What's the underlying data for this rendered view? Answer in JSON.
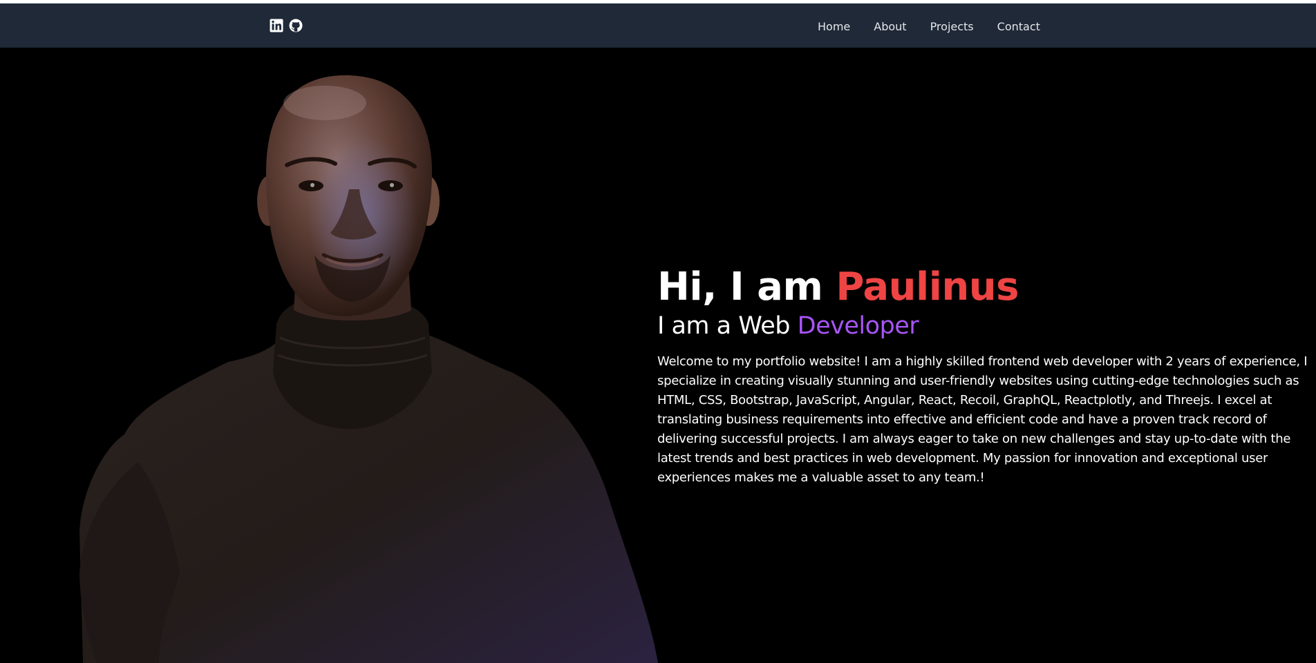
{
  "navbar": {
    "social": [
      {
        "icon": "linkedin-icon"
      },
      {
        "icon": "github-icon"
      }
    ],
    "links": [
      {
        "label": "Home"
      },
      {
        "label": "About"
      },
      {
        "label": "Projects"
      },
      {
        "label": "Contact"
      }
    ]
  },
  "hero": {
    "greeting_prefix": "Hi, I am ",
    "name": "Paulinus",
    "role_prefix": "I am a Web ",
    "role_highlight": "Developer",
    "bio": "Welcome to my portfolio website! I am a highly skilled frontend web developer with 2 years of experience, I specialize in creating visually stunning and user-friendly websites using cutting-edge technologies such as HTML, CSS, Bootstrap, JavaScript, Angular, React, Recoil, GraphQL, Reactplotly, and Threejs. I excel at translating business requirements into effective and efficient code and have a proven track record of delivering successful projects. I am always eager to take on new challenges and stay up-to-date with the latest trends and best practices in web development. My passion for innovation and exceptional user experiences makes me a valuable asset to any team.!"
  },
  "colors": {
    "navbar_bg": "#1f2937",
    "page_bg": "#000000",
    "name_accent": "#ef4444",
    "role_accent": "#a855f7"
  }
}
